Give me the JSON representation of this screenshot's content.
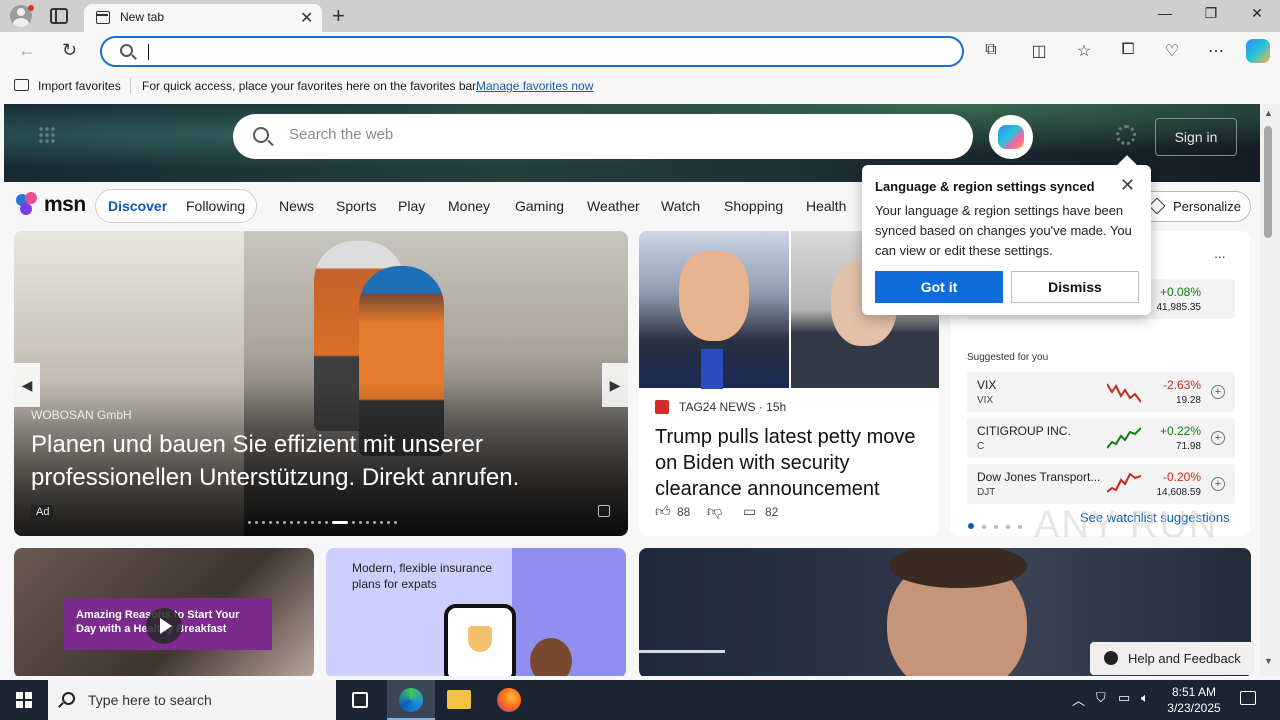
{
  "browser": {
    "tab_title": "New tab",
    "address_value": "",
    "favorites_bar": {
      "import_label": "Import favorites",
      "hint": "For quick access, place your favorites here on the favorites bar.",
      "manage_link": "Manage favorites now"
    }
  },
  "msn": {
    "search_placeholder": "Search the web",
    "sign_in": "Sign in",
    "logo_text": "msn",
    "feed_tabs": [
      "Discover",
      "Following"
    ],
    "nav": [
      "News",
      "Sports",
      "Play",
      "Money",
      "Gaming",
      "Weather",
      "Watch",
      "Shopping",
      "Health"
    ],
    "personalize": "Personalize"
  },
  "carousel": {
    "sponsor": "WOBOSAN GmbH",
    "title": "Planen und bauen Sie effizient mit unserer professionellen Unterstützung. Direkt anrufen.",
    "ad_label": "Ad",
    "active_slide": 12
  },
  "news_card": {
    "source": "TAG24 NEWS",
    "age": "15h",
    "title": "Trump pulls latest petty move on Biden with security clearance announcement",
    "likes": "88",
    "comments": "82"
  },
  "watchlist": {
    "more": "...",
    "top_row": {
      "change": "+0.08%",
      "price": "41,985.35",
      "color": "#107c10"
    },
    "suggested_label": "Suggested for you",
    "rows": [
      {
        "name": "VIX",
        "symbol": "VIX",
        "change": "-2.63%",
        "price": "19.28",
        "color": "#c42b1c"
      },
      {
        "name": "CITIGROUP INC.",
        "symbol": "C",
        "change": "+0.22%",
        "price": "71.98",
        "color": "#107c10"
      },
      {
        "name": "Dow Jones Transport...",
        "symbol": "DJT",
        "change": "-0.20%",
        "price": "14,608.59",
        "color": "#c42b1c"
      }
    ],
    "see_link": "See watchlist suggestions"
  },
  "popup": {
    "title": "Language & region settings synced",
    "body": "Your language & region settings have been synced based on changes you've made. You can view or edit these settings.",
    "primary": "Got it",
    "secondary": "Dismiss"
  },
  "bottom_cards": {
    "video_banner": "Amazing Reasons to Start Your Day with a Healthy Breakfast",
    "insurance_text": "Modern, flexible insurance plans for expats"
  },
  "overlay": {
    "watermark": "ANY RUN",
    "help": "Help and Feedback"
  },
  "taskbar": {
    "search_placeholder": "Type here to search",
    "time": "8:51 AM",
    "date": "3/23/2025"
  },
  "colors": {
    "accent": "#0f6cdb",
    "link": "#0b5cad",
    "positive": "#107c10",
    "negative": "#c42b1c"
  }
}
